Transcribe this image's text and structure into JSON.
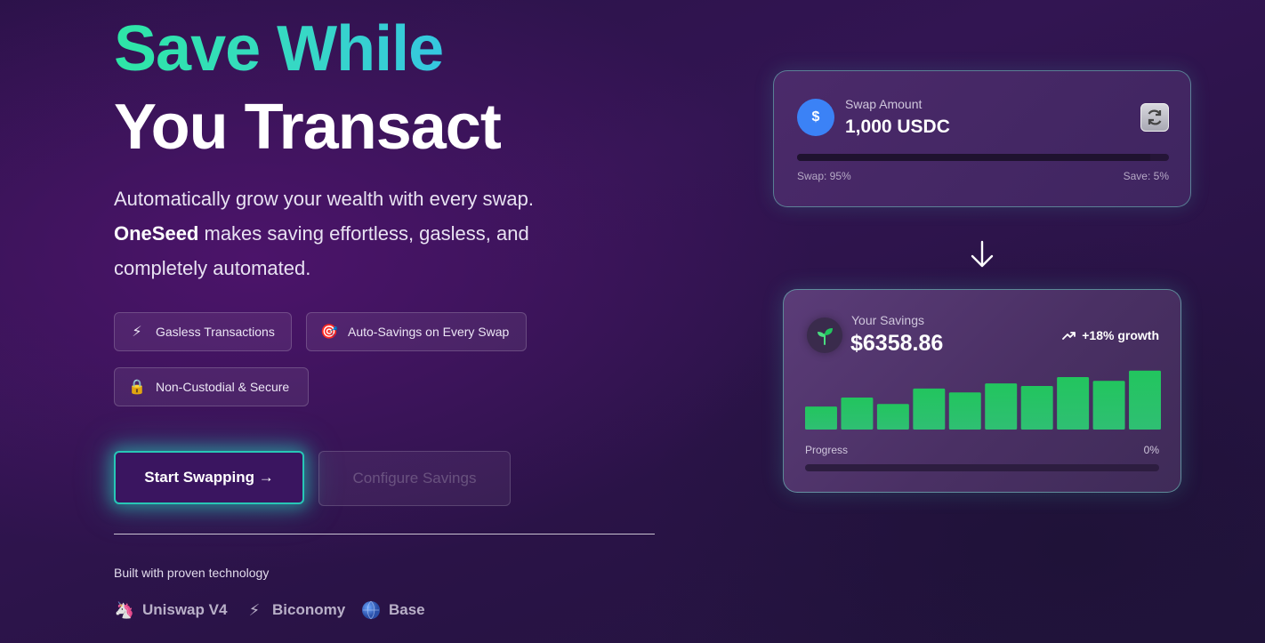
{
  "hero": {
    "title_line1": "Save While",
    "title_line2": "You Transact",
    "desc_part1": "Automatically grow your wealth with every swap.",
    "desc_brand": "OneSeed",
    "desc_part2": " makes saving effortless, gasless, and completely automated."
  },
  "features": [
    {
      "icon": "lightning-icon",
      "glyph": "⚡",
      "label": "Gasless Transactions"
    },
    {
      "icon": "target-icon",
      "glyph": "🎯",
      "label": "Auto-Savings on Every Swap"
    },
    {
      "icon": "lock-icon",
      "glyph": "🔒",
      "label": "Non-Custodial & Secure"
    }
  ],
  "actions": {
    "start_label": "Start Swapping →",
    "config_label": "Configure Savings"
  },
  "tech": {
    "heading": "Built with proven technology",
    "items": [
      {
        "icon": "unicorn-icon",
        "glyph": "🦄",
        "label": "Uniswap V4"
      },
      {
        "icon": "lightning-icon",
        "glyph": "⚡",
        "label": "Biconomy"
      },
      {
        "icon": "globe-icon",
        "glyph": "🌐",
        "label": "Base"
      }
    ]
  },
  "swap_card": {
    "avatar_glyph": "$",
    "label": "Swap Amount",
    "value": "1,000 USDC",
    "swap_text": "Swap: 95%",
    "save_text": "Save: 5%",
    "swap_fraction": 0.95
  },
  "savings_card": {
    "label": "Your Savings",
    "value": "$6358.86",
    "growth": "+18% growth",
    "bar_levels": [
      0.36,
      0.5,
      0.4,
      0.64,
      0.58,
      0.72,
      0.68,
      0.82,
      0.76,
      0.92
    ],
    "progress_label": "Progress",
    "progress_value": "0%",
    "progress_fraction": 0
  },
  "colors": {
    "accent_teal": "#27c7b6",
    "title_gradient_start": "#2ee6a6",
    "title_gradient_end": "#35c7e0",
    "bar_green": "#22c55e",
    "usdc_blue": "#3b82f6"
  }
}
